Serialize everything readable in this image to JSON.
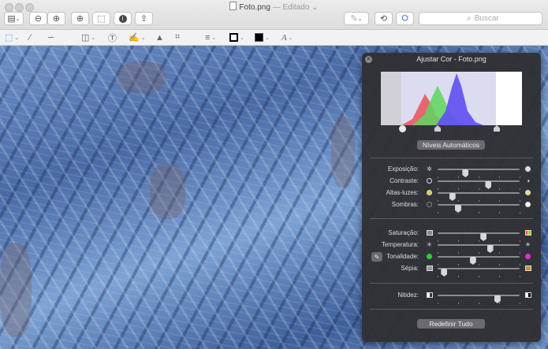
{
  "window": {
    "title": "Foto.png",
    "status": "— Editado",
    "status_chevron": "⌄"
  },
  "toolbar": {
    "sidebar_icon": "sidebar-icon",
    "zoom_out_icon": "zoom-out-icon",
    "zoom_in_icon": "zoom-in-icon",
    "zoom_fit_icon": "zoom-fit-icon",
    "info_icon": "info-icon",
    "share_icon": "share-icon",
    "pen_icon": "pen-icon",
    "rotate_icon": "rotate-icon",
    "markup_icon": "toolbox-icon",
    "search_placeholder": "Buscar"
  },
  "markup_tools": [
    "selection-icon",
    "magic-wand-icon",
    "sketch-icon",
    "shapes-icon",
    "text-icon",
    "sign-icon",
    "adjust-color-icon",
    "crop-icon",
    "line-style-icon",
    "border-color-icon",
    "fill-color-icon",
    "font-icon"
  ],
  "colors": {
    "accent": "#2a7de1",
    "panel_bg": "#303034",
    "histogram_red": "#e8505a",
    "histogram_green": "#5ed65e",
    "histogram_blue": "#5f4ff2"
  },
  "panel": {
    "title": "Ajustar Cor - Foto.png",
    "auto_levels_label": "Níveis Automáticos",
    "reset_label": "Redefinir Tudo",
    "group1": [
      {
        "label": "Exposição:",
        "value": 0.34
      },
      {
        "label": "Contraste:",
        "value": 0.62
      },
      {
        "label": "Altas-luzes:",
        "value": 0.18
      },
      {
        "label": "Sombras:",
        "value": 0.25
      }
    ],
    "group2": [
      {
        "label": "Saturação:",
        "value": 0.56
      },
      {
        "label": "Temperatura:",
        "value": 0.64
      },
      {
        "label": "Tonalidade:",
        "value": 0.43
      },
      {
        "label": "Sépia:",
        "value": 0.08
      }
    ],
    "group3": [
      {
        "label": "Nitidez:",
        "value": 0.73
      }
    ]
  }
}
